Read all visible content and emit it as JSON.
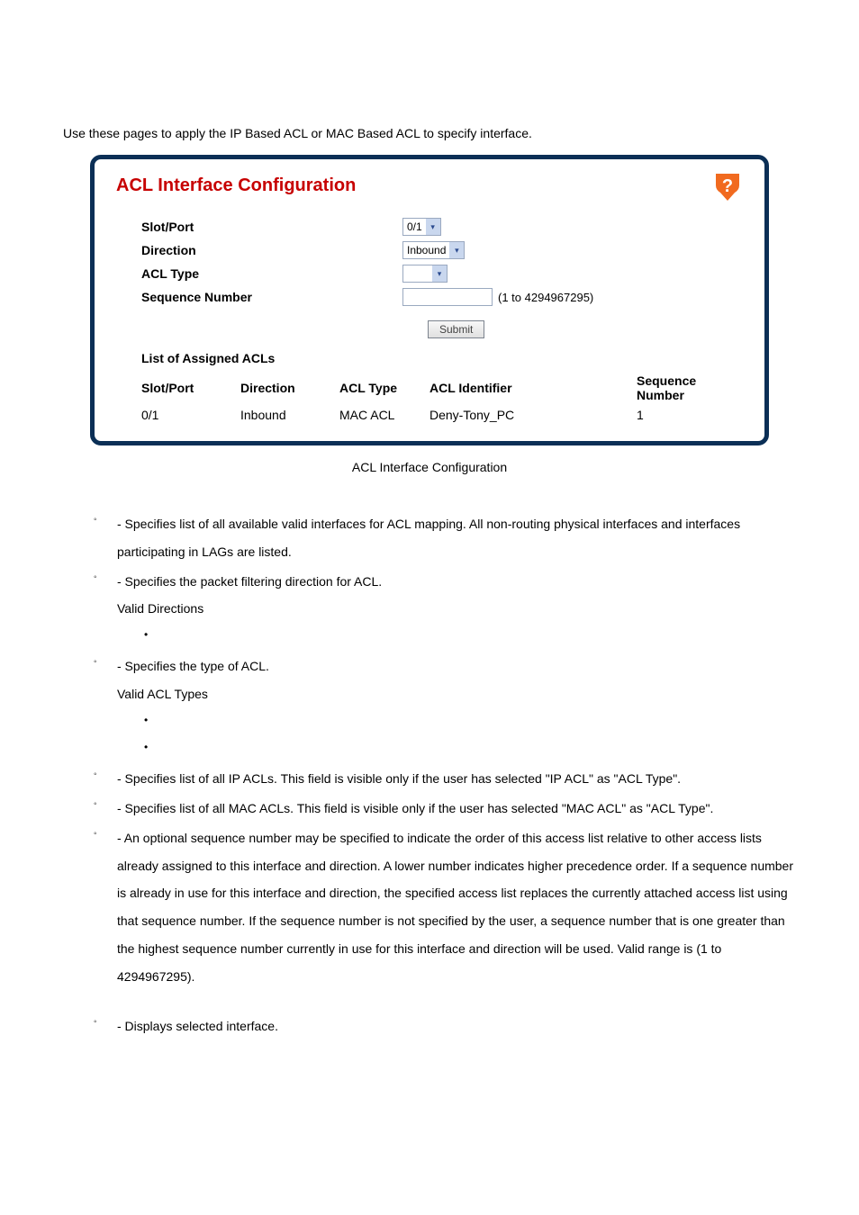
{
  "intro": "Use these pages to apply the IP Based ACL or MAC Based ACL to specify interface.",
  "panel": {
    "title": "ACL Interface Configuration",
    "helpIcon": "?",
    "fields": {
      "slotport_label": "Slot/Port",
      "slotport_value": "0/1",
      "direction_label": "Direction",
      "direction_value": "Inbound",
      "acltype_label": "ACL Type",
      "acltype_value": "",
      "seqnum_label": "Sequence Number",
      "seqnum_value": "",
      "seqnum_hint": "(1 to 4294967295)"
    },
    "submit_label": "Submit",
    "list_title": "List of Assigned ACLs",
    "table": {
      "headers": {
        "slotport": "Slot/Port",
        "direction": "Direction",
        "acltype": "ACL Type",
        "aclid": "ACL Identifier",
        "seq": "Sequence Number"
      },
      "row": {
        "slotport": "0/1",
        "direction": "Inbound",
        "acltype": "MAC ACL",
        "aclid": "Deny-Tony_PC",
        "seq": "1"
      }
    }
  },
  "caption": "ACL Interface Configuration",
  "desc": {
    "slotport": " - Specifies list of all available valid interfaces for ACL mapping. All non-routing physical interfaces and interfaces participating in LAGs are listed.",
    "direction": " - Specifies the packet filtering direction for ACL.",
    "valid_directions": "Valid Directions",
    "acltype": " - Specifies the type of ACL.",
    "valid_acltypes": "Valid ACL Types",
    "ipacl": " - Specifies list of all IP ACLs. This field is visible only if the user has selected \"IP ACL\" as \"ACL Type\".",
    "macacl": " - Specifies list of all MAC ACLs. This field is visible only if the user has selected \"MAC ACL\" as \"ACL Type\".",
    "seqnum": " - An optional sequence number may be specified to indicate the order of this access list relative to other access lists already assigned to this interface and direction. A lower number indicates higher precedence order. If a sequence number is already in use for this interface and direction, the specified access list replaces the currently attached access list using that sequence number. If the sequence number is not specified by the user, a sequence number that is one greater than the highest sequence number currently in use for this interface and direction will be used. Valid range is (1 to 4294967295).",
    "displays_interface": " - Displays selected interface."
  }
}
